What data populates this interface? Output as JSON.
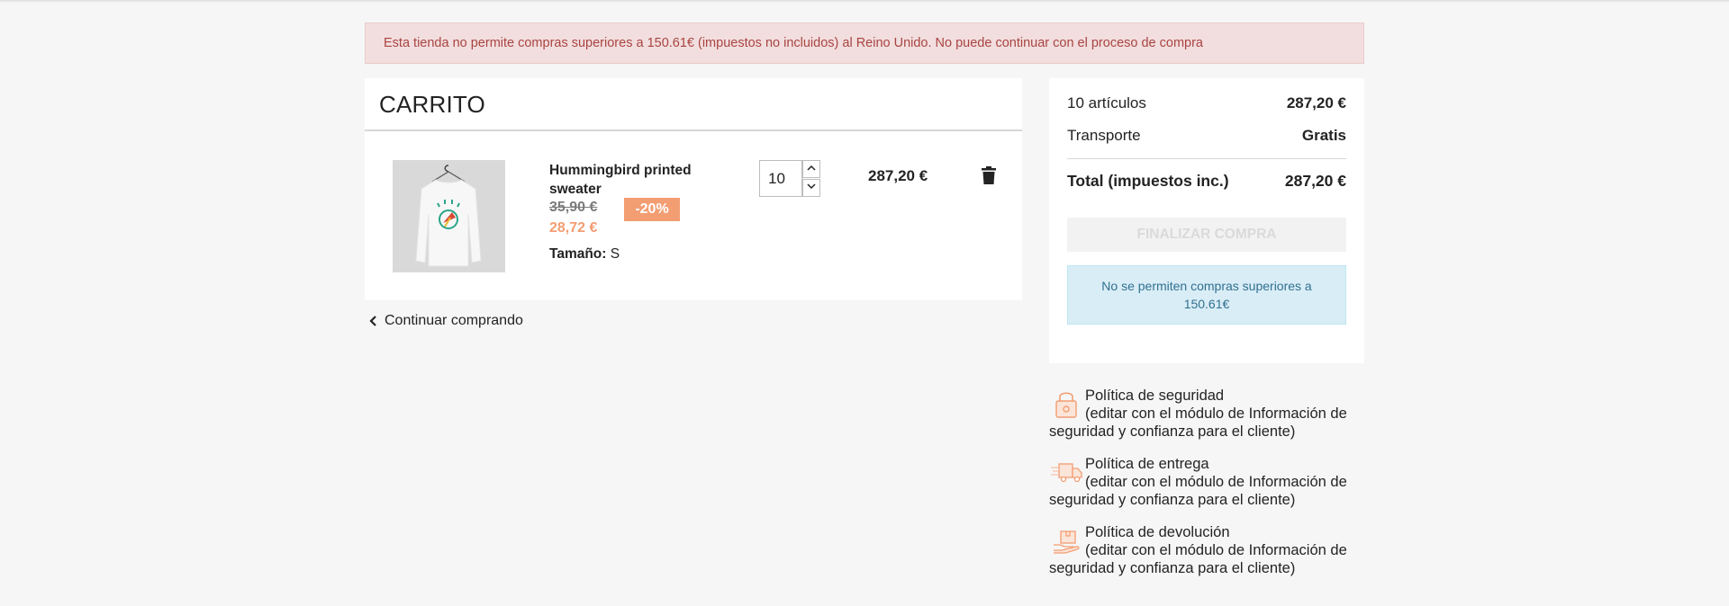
{
  "alert": {
    "message": "Esta tienda no permite compras superiores a 150.61€ (impuestos no incluidos) al Reino Unido. No puede continuar con el proceso de compra"
  },
  "cart": {
    "title": "CARRITO",
    "item": {
      "name": "Hummingbird printed sweater",
      "old_price": "35,90 €",
      "discount": "-20%",
      "new_price": "28,72 €",
      "size_label": "Tamaño:",
      "size_value": "S",
      "quantity": "10",
      "line_total": "287,20 €"
    },
    "continue_label": "Continuar comprando"
  },
  "summary": {
    "items_label": "10 artículos",
    "items_value": "287,20 €",
    "shipping_label": "Transporte",
    "shipping_value": "Gratis",
    "total_label": "Total (impuestos inc.)",
    "total_value": "287,20 €",
    "checkout_label": "FINALIZAR COMPRA",
    "info_message": "No se permiten compras superiores a 150.61€"
  },
  "reassurance": [
    {
      "title": "Política de seguridad",
      "desc": "(editar con el módulo de Información de seguridad y confianza para el cliente)",
      "icon": "lock-icon"
    },
    {
      "title": "Política de entrega",
      "desc": "(editar con el módulo de Información de seguridad y confianza para el cliente)",
      "icon": "delivery-truck-icon"
    },
    {
      "title": "Política de devolución",
      "desc": "(editar con el módulo de Información de seguridad y confianza para el cliente)",
      "icon": "return-package-icon"
    }
  ],
  "colors": {
    "accent": "#f39d72",
    "alert_bg": "#f2dede",
    "alert_text": "#a94442",
    "info_bg": "#d9edf7",
    "info_text": "#31708f"
  }
}
